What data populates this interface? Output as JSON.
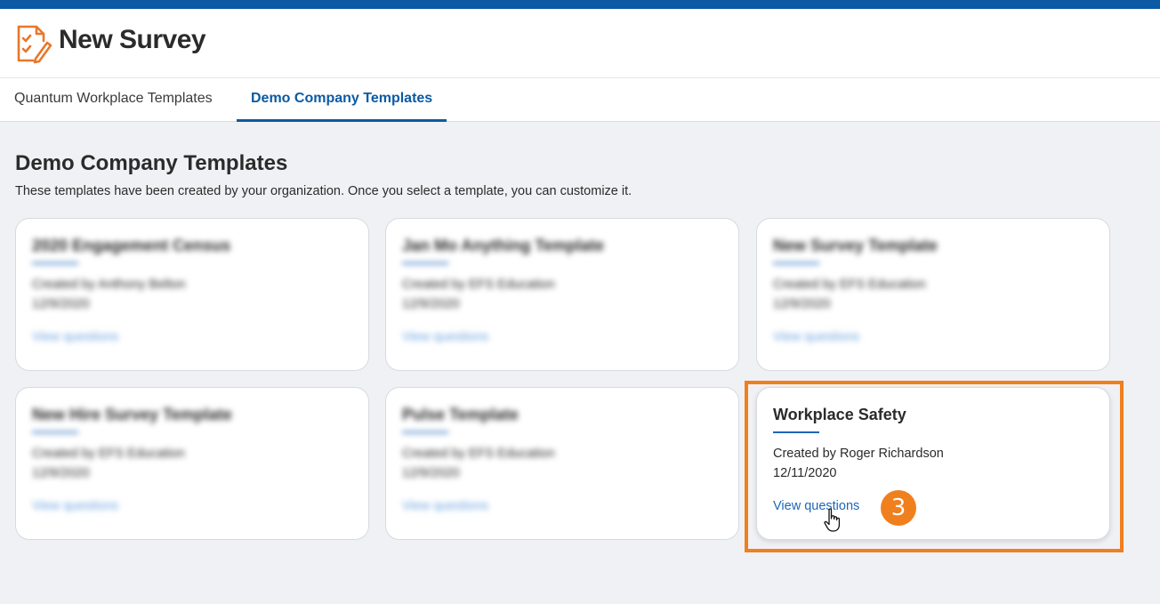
{
  "header": {
    "title": "New Survey",
    "icon": "survey-checklist-icon",
    "accent_color": "#0b5aa3",
    "icon_color": "#e8772b"
  },
  "tabs": [
    {
      "label": "Quantum Workplace Templates",
      "active": false
    },
    {
      "label": "Demo Company Templates",
      "active": true
    }
  ],
  "section": {
    "title": "Demo Company Templates",
    "subtitle": "These templates have been created by your organization. Once you select a template, you can customize it."
  },
  "cards": [
    {
      "title": "2020 Engagement Census",
      "created_by": "Created by Anthony Belton",
      "date": "12/9/2020",
      "link": "View questions",
      "obscured": true
    },
    {
      "title": "Jan Mo Anything Template",
      "created_by": "Created by EFS Education",
      "date": "12/9/2020",
      "link": "View questions",
      "obscured": true
    },
    {
      "title": "New Survey Template",
      "created_by": "Created by EFS Education",
      "date": "12/9/2020",
      "link": "View questions",
      "obscured": true
    },
    {
      "title": "New Hire Survey Template",
      "created_by": "Created by EFS Education",
      "date": "12/9/2020",
      "link": "View questions",
      "obscured": true
    },
    {
      "title": "Pulse Template",
      "created_by": "Created by EFS Education",
      "date": "12/9/2020",
      "link": "View questions",
      "obscured": true
    },
    {
      "title": "Workplace Safety",
      "created_by": "Created by Roger Richardson",
      "date": "12/11/2020",
      "link": "View questions",
      "obscured": false
    }
  ],
  "annotation": {
    "step_number": "3",
    "highlight_color": "#f07f1e"
  }
}
